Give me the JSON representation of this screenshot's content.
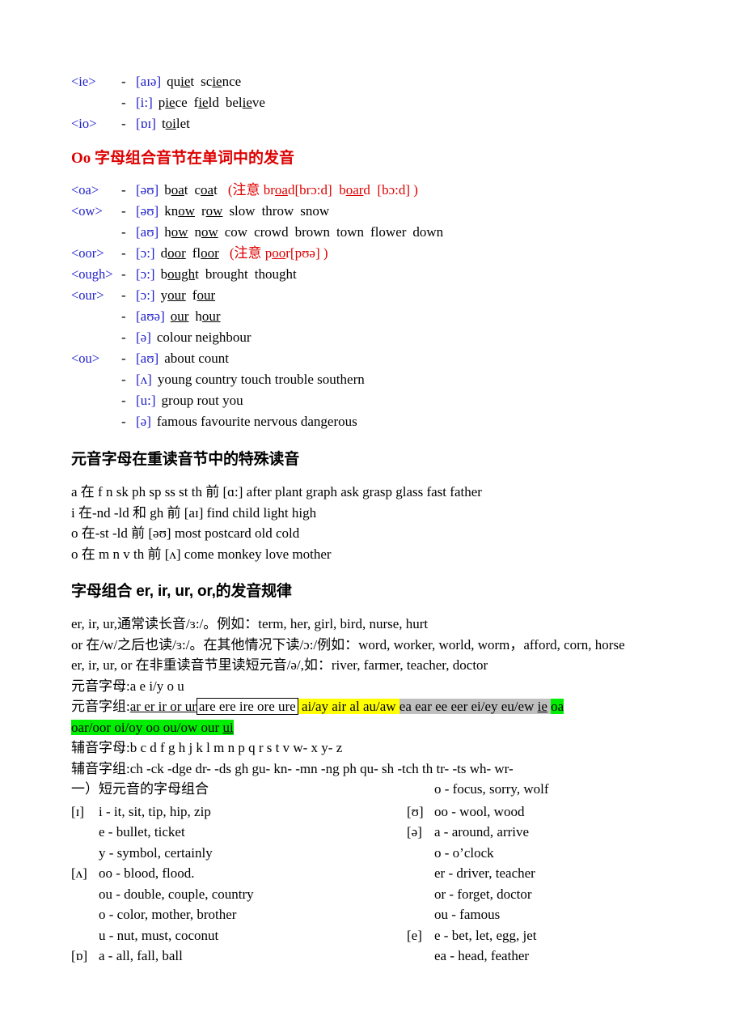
{
  "ie_io_block": {
    "rows": [
      {
        "tag": "<ie>",
        "dash": "-",
        "ipa": "[aɪə]",
        "words": "quiet science",
        "underlined": [
          "ie",
          "ie"
        ]
      },
      {
        "tag": "",
        "dash": "-",
        "ipa": "[i:]",
        "words": "piece field believe"
      },
      {
        "tag": "<io>",
        "dash": "-",
        "ipa": "[ɒɪ]",
        "words": "toilet"
      }
    ]
  },
  "oo_heading": "Oo 字母组合音节在单词中的发音",
  "oo_rows": [
    {
      "tag": "<oa>",
      "dash": "-",
      "ipa": "[əʊ]",
      "w1": "b",
      "u1": "oa",
      "w1b": "t",
      "w2": "c",
      "u2": "oa",
      "w2b": "t",
      "note": "(注意 broad[brɔ:d]  board  [bɔ:d] )"
    },
    {
      "tag": "<ow>",
      "dash": "-",
      "ipa": "[əʊ]",
      "words": "know row slow throw snow"
    },
    {
      "tag": "",
      "dash": "-",
      "ipa": "[aʊ]",
      "words": "how now cow crowd brown town flower down"
    },
    {
      "tag": "<oor>",
      "dash": "-",
      "ipa": "[ɔ:]",
      "words": "door floor",
      "note": "(注意 poor[pʊə] )"
    },
    {
      "tag": "<ough>",
      "dash": "-",
      "ipa": "[ɔ:]",
      "words": "bought brought thought"
    },
    {
      "tag": "<our>",
      "dash": "-",
      "ipa": "[ɔ:]",
      "words": "your four"
    },
    {
      "tag": "",
      "dash": "-",
      "ipa": "[aʊə]",
      "words": "our hour"
    },
    {
      "tag": "",
      "dash": "-",
      "ipa": "[ə]",
      "words": "colour neighbour"
    },
    {
      "tag": "<ou>",
      "dash": "-",
      "ipa": "[aʊ]",
      "words": "about count"
    },
    {
      "tag": "",
      "dash": "-",
      "ipa": "[ʌ]",
      "words": "young country touch trouble southern"
    },
    {
      "tag": "",
      "dash": "-",
      "ipa": "[u:]",
      "words": "group rout you"
    },
    {
      "tag": "",
      "dash": "-",
      "ipa": "[ə]",
      "words": "famous favourite nervous dangerous"
    }
  ],
  "special_heading": "元音字母在重读音节中的特殊读音",
  "special_lines": [
    "a 在 f n sk ph sp ss st th 前  [ɑ:] after plant graph ask grasp glass fast father",
    "i 在-nd -ld 和 gh 前  [aɪ] find child light high",
    "o 在-st -ld 前  [əʊ] most postcard old cold",
    "o 在 m n v th 前  [ʌ] come monkey love mother"
  ],
  "er_heading": "字母组合 er, ir, ur, or,的发音规律",
  "er_lines": [
    "er, ir, ur,通常读长音/ɜ:/。例如：term, her, girl, bird, nurse, hurt",
    "or 在/w/之后也读/ɜ:/。在其他情况下读/ɔ:/例如：word, worker, world, worm，afford, corn, horse",
    "er, ir, ur, or 在非重读音节里读短元音/ə/,如：river, farmer, teacher, doctor"
  ],
  "vowel_letters_label": "元音字母:",
  "vowel_letters_value": "a e i/y o u",
  "vowel_groups_label": "元音字组:",
  "vowel_groups": {
    "underlined_run": "ar er ir or ur",
    "boxed_run": "are ere ire ore ure",
    "yellow_run": "ai/ay air al au/aw",
    "grey_run": "ea ear ee eer ei/ey eu/ew",
    "grey_underlined": "ie",
    "green_run1": "oa",
    "green_run2": "oar/oor oi/oy oo ou/ow our",
    "green_underlined": "ui"
  },
  "consonant_letters_label": "辅音字母:",
  "consonant_letters_value": "b c d f g h j k l m n p q r s t v w- x y- z",
  "consonant_groups_label": "辅音字组:",
  "consonant_groups_value": "ch -ck -dge dr- -ds gh gu- kn- -mn -ng ph qu- sh -tch th tr- -ts wh- wr-",
  "short_vowel_heading": "一）短元音的字母组合",
  "left_column": [
    {
      "sym": "[ɪ]",
      "text": "i - it, sit, tip, hip, zip"
    },
    {
      "sym": "",
      "text": "e - bullet, ticket"
    },
    {
      "sym": "",
      "text": "y - symbol, certainly"
    },
    {
      "sym": "[ʌ]",
      "text": "oo - blood, flood."
    },
    {
      "sym": "",
      "text": "ou - double, couple, country"
    },
    {
      "sym": "",
      "text": "o - color, mother, brother"
    },
    {
      "sym": "",
      "text": "u - nut, must, coconut"
    },
    {
      "sym": "[ɒ]",
      "text": "a - all, fall, ball"
    }
  ],
  "right_column": [
    {
      "sym": "",
      "text": "o - focus, sorry, wolf"
    },
    {
      "sym": "[ʊ]",
      "text": "oo - wool, wood"
    },
    {
      "sym": "[ə]",
      "text": "a - around, arrive"
    },
    {
      "sym": "",
      "text": "o - o’clock"
    },
    {
      "sym": "",
      "text": "er - driver, teacher"
    },
    {
      "sym": "",
      "text": "or - forget, doctor"
    },
    {
      "sym": "",
      "text": "ou - famous"
    },
    {
      "sym": "[e]",
      "text": "e - bet, let, egg, jet"
    },
    {
      "sym": "",
      "text": "ea - head, feather"
    }
  ],
  "colors": {
    "heading_red": "#dd0000",
    "tag_blue": "#2222cc",
    "highlight_yellow": "#ffff00",
    "highlight_grey": "#bfbfbf",
    "highlight_green": "#00ee00"
  }
}
